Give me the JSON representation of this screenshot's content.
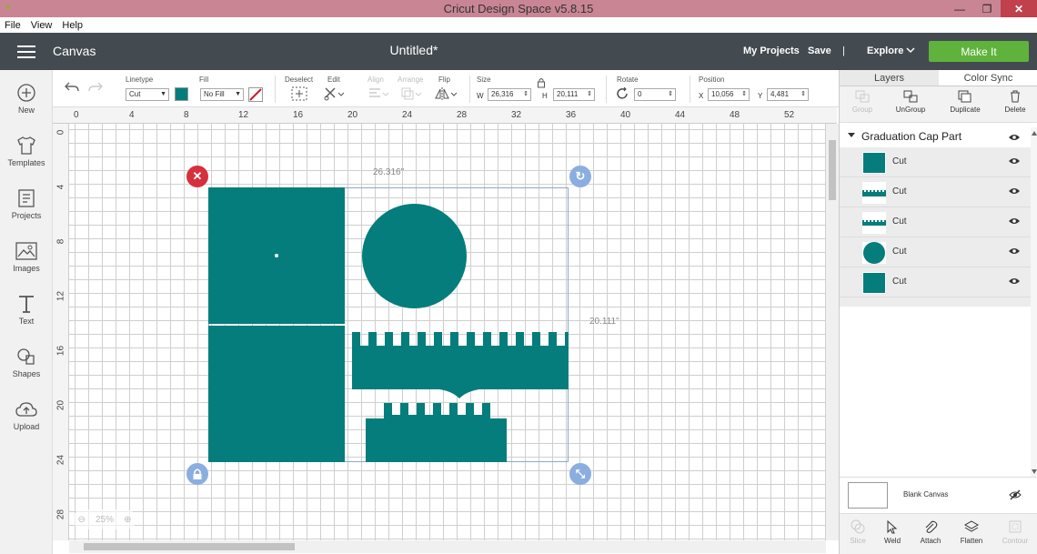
{
  "window": {
    "title": "Cricut Design Space  v5.8.15"
  },
  "menu": [
    "File",
    "View",
    "Help"
  ],
  "header": {
    "section": "Canvas",
    "doc_title": "Untitled*",
    "my_projects": "My Projects",
    "save": "Save",
    "divider": "|",
    "explore": "Explore",
    "make_it": "Make It"
  },
  "leftbar": [
    {
      "label": "New",
      "icon": "plus-circle-icon"
    },
    {
      "label": "Templates",
      "icon": "tshirt-icon"
    },
    {
      "label": "Projects",
      "icon": "projects-icon"
    },
    {
      "label": "Images",
      "icon": "image-icon"
    },
    {
      "label": "Text",
      "icon": "text-t-icon"
    },
    {
      "label": "Shapes",
      "icon": "shapes-icon"
    },
    {
      "label": "Upload",
      "icon": "cloud-upload-icon"
    }
  ],
  "toolbar": {
    "linetype_label": "Linetype",
    "linetype_value": "Cut",
    "fill_label": "Fill",
    "fill_value": "No Fill",
    "deselect": "Deselect",
    "edit": "Edit",
    "align": "Align",
    "arrange": "Arrange",
    "flip": "Flip",
    "size_label": "Size",
    "w_label": "W",
    "w_value": "26,316",
    "h_label": "H",
    "h_value": "20,111",
    "rotate_label": "Rotate",
    "rotate_value": "0",
    "position_label": "Position",
    "x_label": "X",
    "x_value": "10,056",
    "y_label": "Y",
    "y_value": "4,481",
    "shape_color": "#047d7c"
  },
  "ruler_h": [
    "0",
    "4",
    "8",
    "12",
    "16",
    "20",
    "24",
    "28",
    "32",
    "36",
    "40",
    "44",
    "48",
    "52"
  ],
  "ruler_v": [
    "0",
    "4",
    "8",
    "12",
    "16",
    "20",
    "24",
    "28"
  ],
  "canvas": {
    "width_label": "26.316\"",
    "height_label": "20.111\"",
    "zoom": "25%"
  },
  "panel": {
    "tabs": [
      "Layers",
      "Color Sync"
    ],
    "tools": [
      {
        "label": "Group",
        "enabled": false
      },
      {
        "label": "UnGroup",
        "enabled": true
      },
      {
        "label": "Duplicate",
        "enabled": true
      },
      {
        "label": "Delete",
        "enabled": true
      }
    ],
    "group_name": "Graduation Cap Part",
    "layers": [
      {
        "label": "Cut",
        "thumb": "square"
      },
      {
        "label": "Cut",
        "thumb": "strip-top"
      },
      {
        "label": "Cut",
        "thumb": "strip-wide"
      },
      {
        "label": "Cut",
        "thumb": "circle"
      },
      {
        "label": "Cut",
        "thumb": "square-dot"
      }
    ],
    "blank_canvas": "Blank Canvas",
    "bottom_tools": [
      {
        "label": "Slice",
        "enabled": false
      },
      {
        "label": "Weld",
        "enabled": true
      },
      {
        "label": "Attach",
        "enabled": true
      },
      {
        "label": "Flatten",
        "enabled": true
      },
      {
        "label": "Contour",
        "enabled": false
      }
    ]
  },
  "colors": {
    "teal": "#047d7c",
    "make_it": "#5fb33c",
    "header": "#444b50",
    "titlebar": "#c98594"
  }
}
